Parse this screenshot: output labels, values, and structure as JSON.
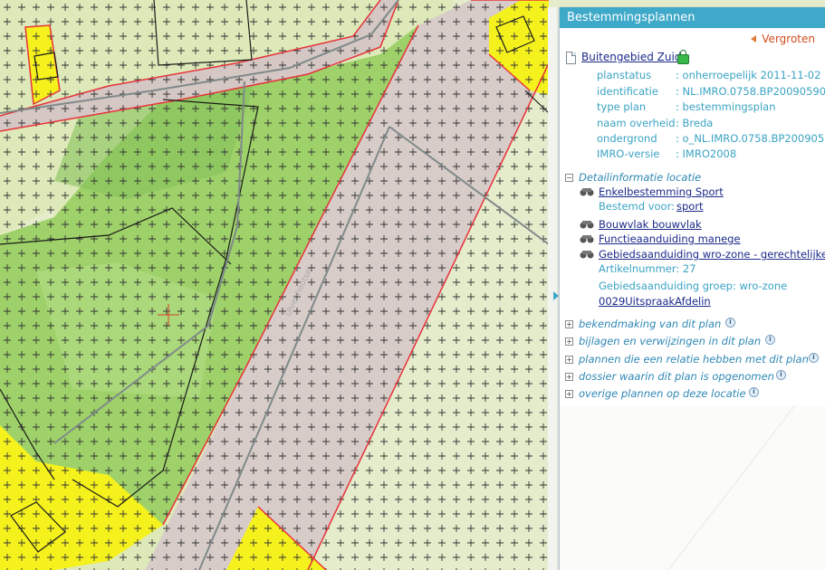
{
  "panel": {
    "title": "Bestemmingsplannen",
    "enlarge_label": "Vergroten",
    "plan_title": "Buitengebied Zuid",
    "properties": [
      {
        "key": "planstatus",
        "value": ": onherroepelijk 2011-11-02"
      },
      {
        "key": "identificatie",
        "value": ": NL.IMRO.0758.BP20090590"
      },
      {
        "key": "type plan",
        "value": ": bestemmingsplan"
      },
      {
        "key": "naam overheid",
        "value": ": Breda"
      },
      {
        "key": "ondergrond",
        "value": ": o_NL.IMRO.0758.BP200905"
      },
      {
        "key": "IMRO-versie",
        "value": ": IMRO2008"
      }
    ],
    "detail_section": {
      "title": "Detailinformatie locatie",
      "toggle": "−",
      "items": [
        {
          "label": "Enkelbestemming Sport"
        },
        {
          "label": "Bouwvlak bouwvlak"
        },
        {
          "label": "Functieaanduiding manege"
        },
        {
          "label": "Gebiedsaanduiding wro-zone - gerechtelijke"
        }
      ],
      "bestemd_voor_label": "Bestemd voor:",
      "bestemd_voor_value": "sport",
      "artikelnummer": "Artikelnummer: 27",
      "groep": "Gebiedsaanduiding groep: wro-zone",
      "uitspraak_link": "0029UitspraakAfdelin"
    },
    "sections": [
      {
        "title": "bekendmaking van dit plan",
        "toggle": "+"
      },
      {
        "title": "bijlagen en verwijzingen in dit plan",
        "toggle": "+"
      },
      {
        "title": "plannen die een relatie hebben met dit plan",
        "toggle": "+"
      },
      {
        "title": "dossier waarin dit plan is opgenomen",
        "toggle": "+"
      },
      {
        "title": "overige plannen op deze locatie",
        "toggle": "+"
      }
    ]
  },
  "colors": {
    "header": "#3fa9c9",
    "sport_green": "#9fd36a",
    "agri_green": "#d9e8b6",
    "yellow": "#f4f01c",
    "road": "#d6c9c6",
    "boundary": "#e8323a"
  }
}
